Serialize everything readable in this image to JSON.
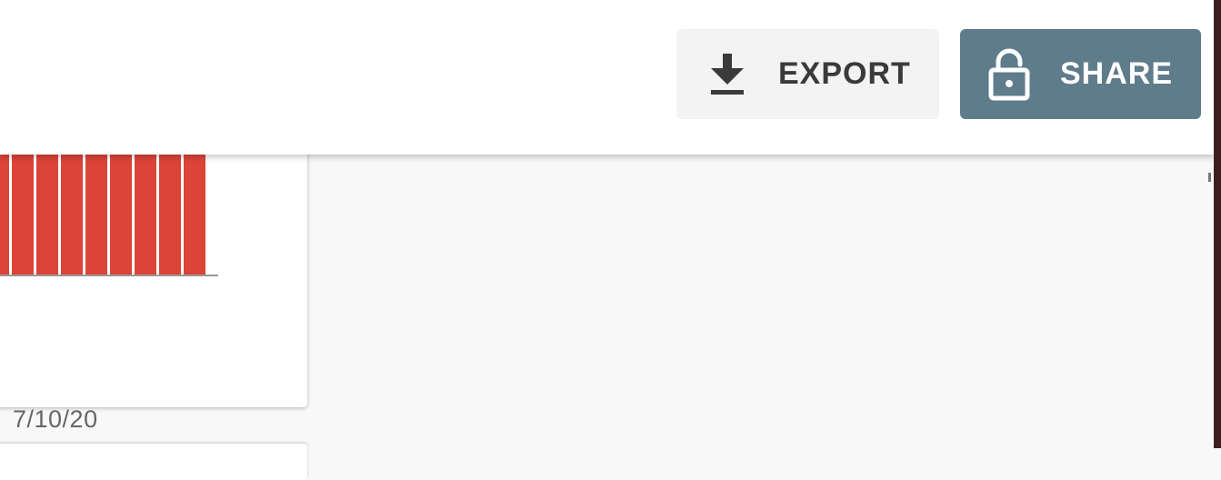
{
  "header": {
    "export_label": "EXPORT",
    "share_label": "SHARE",
    "export_icon": "download-icon",
    "share_icon": "unlock-icon",
    "share_bg_color": "#5e7c8a",
    "export_bg_color": "#f3f3f3"
  },
  "card": {
    "date_label": "7/10/20",
    "bar_color": "#db4437"
  }
}
